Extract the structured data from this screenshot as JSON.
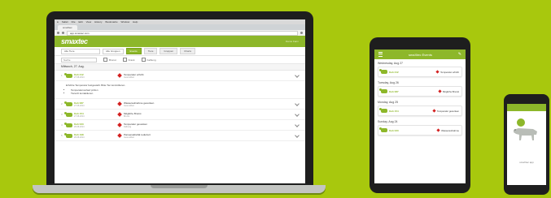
{
  "laptop": {
    "menubar": [
      "Safari",
      "File",
      "Edit",
      "View",
      "History",
      "Bookmarks",
      "Window",
      "Help"
    ],
    "tab_title": "smaXtec",
    "url": "app.smaxtec.com",
    "logo": "smaxtec",
    "header_right": "Demo Farm",
    "toolbar": {
      "selects": [
        "Alle Tiere",
        "Alle Gruppen"
      ],
      "buttons": [
        "Events",
        "Tiere",
        "Gruppen",
        "Charts"
      ],
      "active_index": 0
    },
    "filters": {
      "search_placeholder": "Suche",
      "options": [
        "Brunst",
        "Krank",
        "Kalbung"
      ]
    },
    "date_heading": "Mittwoch, 27. Aug.",
    "events": [
      {
        "num": "1",
        "animal": "Kuh 212",
        "sub": "27.08.2014",
        "alert": "Temperatur erhöht",
        "alert_sub": "Gesundheit"
      },
      {
        "num": "2",
        "animal": "Kuh 087",
        "sub": "27.08.2014",
        "alert": "Wasseraufnahme gesunken",
        "alert_sub": "Gesundheit"
      },
      {
        "num": "3",
        "animal": "Kuh 154",
        "sub": "27.08.2014",
        "alert": "Mögliche Brunst",
        "alert_sub": "Brunst"
      },
      {
        "num": "4",
        "animal": "Kuh 033",
        "sub": "26.08.2014",
        "alert": "Temperatur gesunken",
        "alert_sub": "Kalbung"
      },
      {
        "num": "5",
        "animal": "Kuh 198",
        "sub": "26.08.2014",
        "alert": "Pansenaktivität reduziert",
        "alert_sub": "Gesundheit"
      }
    ],
    "detail": {
      "text": "Erhöhte Temperatur festgestellt. Bitte Tier kontrollieren.",
      "bullets": [
        "Temperaturverlauf prüfen",
        "Tierarzt kontaktieren"
      ]
    }
  },
  "tablet": {
    "title": "smaXtec Events",
    "days": [
      {
        "date": "Wednesday, Aug 27",
        "animal": "Kuh 212",
        "alert": "Temperatur erhöht"
      },
      {
        "date": "Tuesday, Aug 26",
        "animal": "Kuh 087",
        "alert": "Mögliche Brunst"
      },
      {
        "date": "Monday, Aug 25",
        "animal": "Kuh 154",
        "alert": "Temperatur gesunken"
      },
      {
        "date": "Sunday, Aug 24",
        "animal": "Kuh 033",
        "alert": "Wasseraufnahme"
      }
    ]
  },
  "phone": {
    "caption": "smaXtec app"
  },
  "colors": {
    "background": "#a8c80d",
    "brand": "#8db72a",
    "alert": "#d32020"
  }
}
